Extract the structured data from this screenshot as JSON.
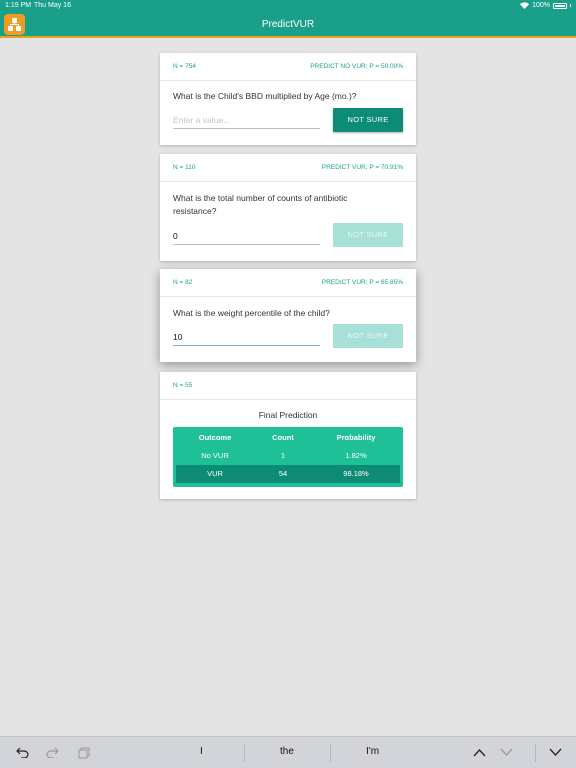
{
  "status": {
    "time": "1:19 PM",
    "date": "Thu May 16",
    "battery": "100%"
  },
  "app": {
    "title": "PredictVUR"
  },
  "cards": [
    {
      "n": "N = 754",
      "prediction": "PREDICT NO VUR; P = 50.00%",
      "question": "What is the Child's BBD multiplied by Age (mo.)?",
      "placeholder": "Enter a value...",
      "value": "",
      "button": "NOT SURE"
    },
    {
      "n": "N = 110",
      "prediction": "PREDICT VUR; P = 70.91%",
      "question": "What is the total number of counts of antibiotic resistance?",
      "value": "0",
      "button": "NOT SURE"
    },
    {
      "n": "N = 82",
      "prediction": "PREDICT VUR; P = 65.85%",
      "question": "What is the weight percentile of the child?",
      "value": "10",
      "button": "NOT SURE"
    }
  ],
  "final": {
    "n": "N = 55",
    "title": "Final Prediction",
    "headers": [
      "Outcome",
      "Count",
      "Probability"
    ],
    "rows": [
      [
        "No VUR",
        "1",
        "1.82%"
      ],
      [
        "VUR",
        "54",
        "98.18%"
      ]
    ]
  },
  "keyboard": {
    "suggestions": [
      "I",
      "the",
      "I'm"
    ]
  },
  "colors": {
    "accent": "#1aa08a",
    "button": "#0c8c75",
    "button_disabled": "#a7e0d6",
    "table": "#1fbf98",
    "nav_underline": "#e8a020",
    "app_icon": "#f49a1e"
  }
}
